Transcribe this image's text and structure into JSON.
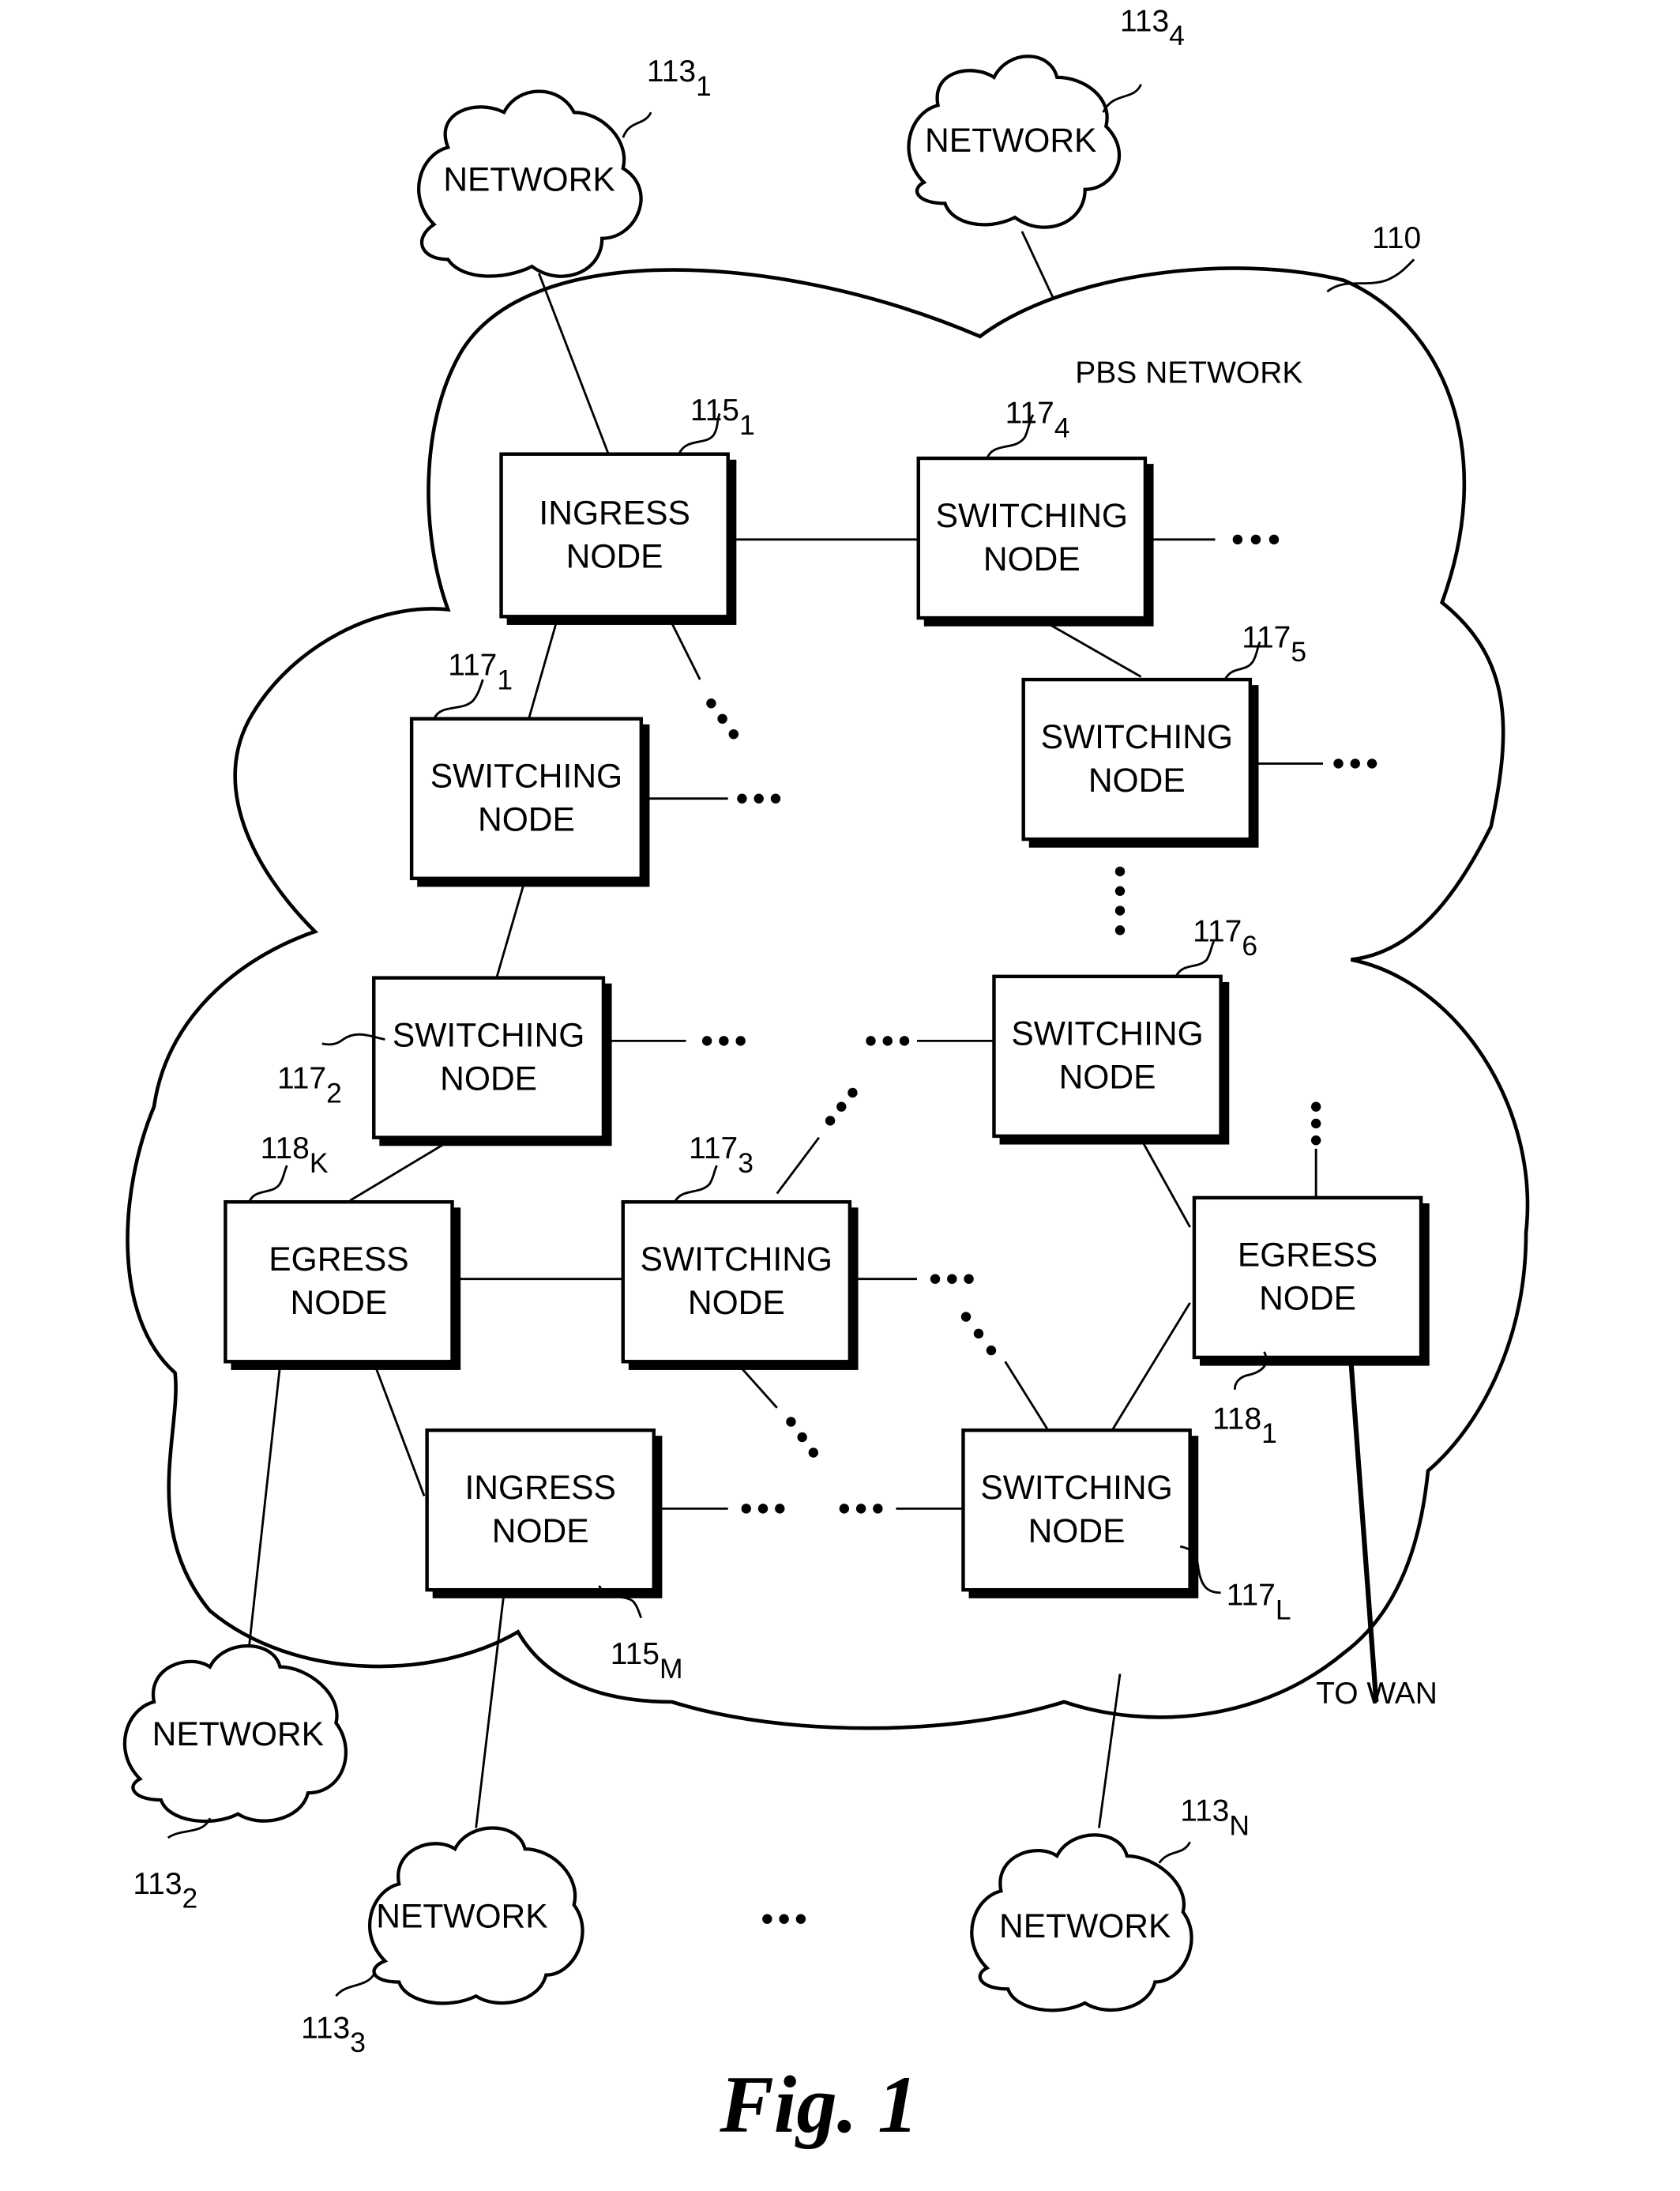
{
  "figure": {
    "caption": "Fig. 1",
    "main_network_label": "PBS NETWORK",
    "main_network_ref": "110",
    "to_wan_label": "TO WAN"
  },
  "external_networks": [
    {
      "label": "NETWORK",
      "ref": "113",
      "sub": "1"
    },
    {
      "label": "NETWORK",
      "ref": "113",
      "sub": "4"
    },
    {
      "label": "NETWORK",
      "ref": "113",
      "sub": "2"
    },
    {
      "label": "NETWORK",
      "ref": "113",
      "sub": "3"
    },
    {
      "label": "NETWORK",
      "ref": "113",
      "sub": "N"
    }
  ],
  "nodes": [
    {
      "line1": "INGRESS",
      "line2": "NODE",
      "ref": "115",
      "sub": "1"
    },
    {
      "line1": "SWITCHING",
      "line2": "NODE",
      "ref": "117",
      "sub": "4"
    },
    {
      "line1": "SWITCHING",
      "line2": "NODE",
      "ref": "117",
      "sub": "1"
    },
    {
      "line1": "SWITCHING",
      "line2": "NODE",
      "ref": "117",
      "sub": "5"
    },
    {
      "line1": "SWITCHING",
      "line2": "NODE",
      "ref": "117",
      "sub": "2"
    },
    {
      "line1": "SWITCHING",
      "line2": "NODE",
      "ref": "117",
      "sub": "6"
    },
    {
      "line1": "EGRESS",
      "line2": "NODE",
      "ref": "118",
      "sub": "K"
    },
    {
      "line1": "SWITCHING",
      "line2": "NODE",
      "ref": "117",
      "sub": "3"
    },
    {
      "line1": "EGRESS",
      "line2": "NODE",
      "ref": "118",
      "sub": "1"
    },
    {
      "line1": "INGRESS",
      "line2": "NODE",
      "ref": "115",
      "sub": "M"
    },
    {
      "line1": "SWITCHING",
      "line2": "NODE",
      "ref": "117",
      "sub": "L"
    }
  ]
}
